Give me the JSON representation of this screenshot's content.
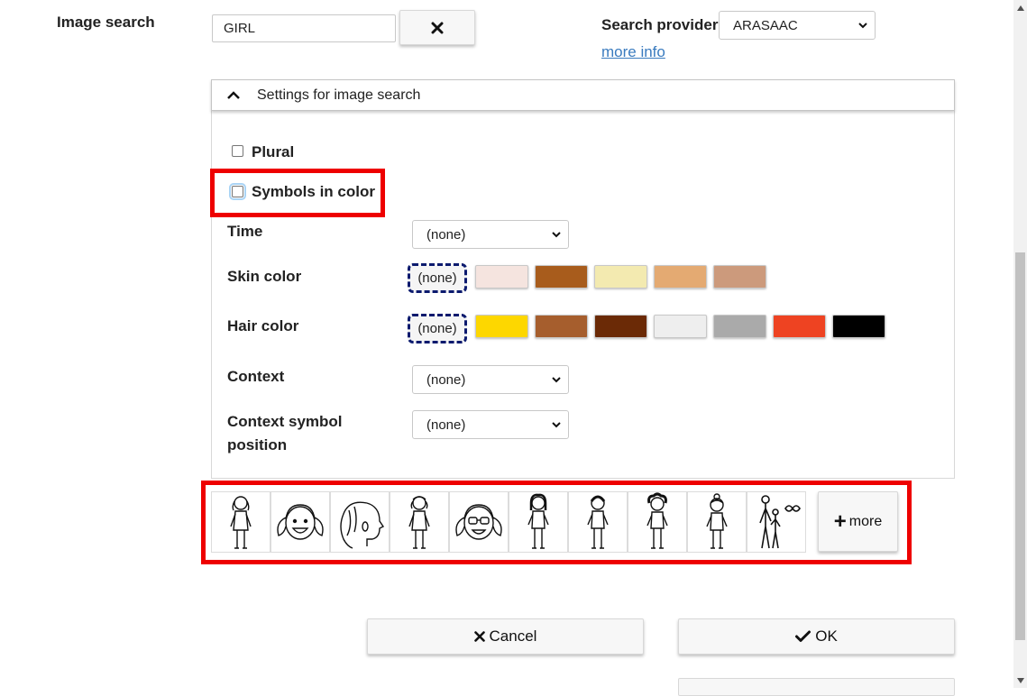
{
  "image_search": {
    "label": "Image search",
    "query": "GIRL",
    "clear_icon": "x-icon"
  },
  "provider": {
    "label": "Search provider",
    "selected": "ARASAAC",
    "more_info": "more info"
  },
  "settings": {
    "title": "Settings for image search",
    "plural_label": "Plural",
    "plural_checked": false,
    "color_label": "Symbols in color",
    "color_checked": false,
    "time": {
      "label": "Time",
      "value": "(none)"
    },
    "skin": {
      "label": "Skin color",
      "none_label": "(none)",
      "colors": [
        "#f5e4df",
        "#a85c1c",
        "#f3eab0",
        "#e4aa72",
        "#cc9a7c"
      ]
    },
    "hair": {
      "label": "Hair color",
      "none_label": "(none)",
      "colors": [
        "#fdd700",
        "#a65e2d",
        "#6b2a06",
        "#eeeeee",
        "#aaaaaa",
        "#ee4322",
        "#000000"
      ]
    },
    "context": {
      "label": "Context",
      "value": "(none)"
    },
    "context_pos": {
      "label_line1": "Context symbol",
      "label_line2": "position",
      "value": "(none)"
    }
  },
  "results": {
    "count": 10,
    "more_label": "more"
  },
  "actions": {
    "cancel_label": "Cancel",
    "ok_label": "OK"
  },
  "highlight_color": "#ee0000"
}
